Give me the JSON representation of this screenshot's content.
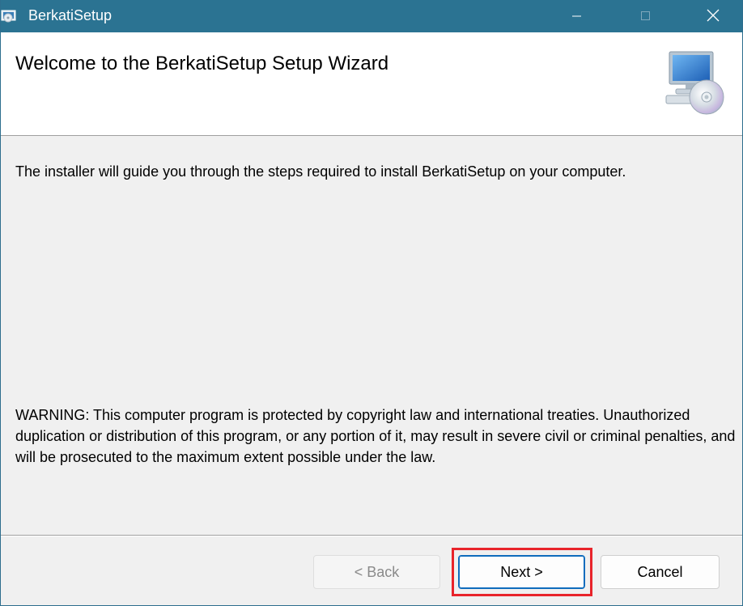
{
  "window": {
    "title": "BerkatiSetup",
    "controls": {
      "minimize": "minimize-icon",
      "maximize": "maximize-icon",
      "close": "close-icon"
    },
    "titlebar_color": "#2b7392"
  },
  "header": {
    "title": "Welcome to the BerkatiSetup Setup Wizard",
    "art_icon": "computer-cd-icon"
  },
  "body": {
    "intro": "The installer will guide you through the steps required to install BerkatiSetup on your computer.",
    "warning": "WARNING: This computer program is protected by copyright law and international treaties. Unauthorized duplication or distribution of this program, or any portion of it, may result in severe civil or criminal penalties, and will be prosecuted to the maximum extent possible under the law."
  },
  "footer": {
    "back_label": "< Back",
    "back_enabled": false,
    "next_label": "Next >",
    "cancel_label": "Cancel",
    "highlight_color": "#e8242b"
  }
}
